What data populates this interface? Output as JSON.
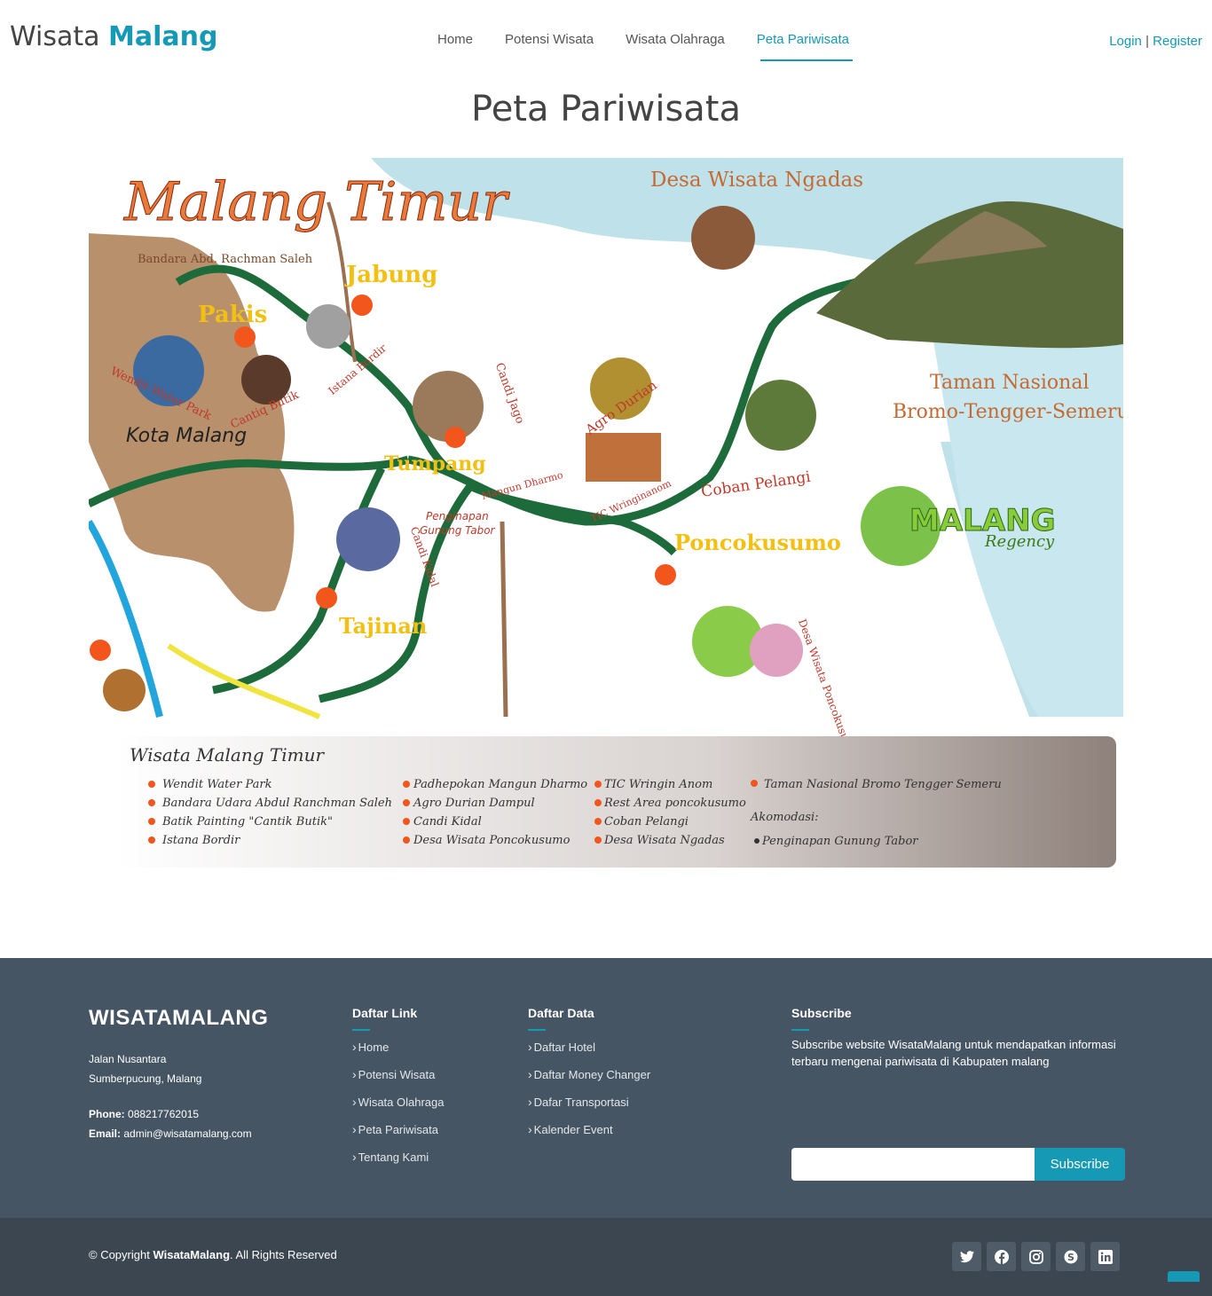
{
  "header": {
    "logo_light": "Wisata",
    "logo_bold": "Malang",
    "nav": [
      "Home",
      "Potensi Wisata",
      "Wisata Olahraga",
      "Peta Pariwisata"
    ],
    "login": "Login",
    "separator": "|",
    "register": "Register"
  },
  "page_title": "Peta Pariwisata",
  "map": {
    "title": "Malang Timur",
    "places": {
      "ngadas": "Desa Wisata Ngadas",
      "bandara": "Bandara Abd. Rachman Saleh",
      "jabung": "Jabung",
      "pakis": "Pakis",
      "istana": "Istana Bordir",
      "wendit": "Wendit Water Park",
      "cantiq": "Cantiq Butik",
      "kota": "Kota Malang",
      "jago": "Candi Jago",
      "agro": "Agro Durian",
      "bromo1": "Taman Nasional",
      "bromo2": "Bromo-Tengger-Semeru",
      "tumpang": "Tumpang",
      "mangun": "Mangun Dharmo",
      "tic": "TIC Wringinanom",
      "coban": "Coban Pelangi",
      "penginapan1": "Penginapan",
      "penginapan2": "Gunung Tabor",
      "kidal": "Candi Kidal",
      "poncokusumo": "Poncokusumo",
      "tajinan": "Tajinan",
      "desa_ponco": "Desa Wisata Poncokusumo",
      "regency1": "MALANG",
      "regency2": "Regency"
    },
    "legend_title": "Wisata Malang Timur",
    "legend_col1": [
      "Wendit Water Park",
      "Bandara Udara Abdul Ranchman Saleh",
      "Batik Painting \"Cantik Butik\"",
      "Istana Bordir"
    ],
    "legend_col2": [
      "Padhepokan Mangun Dharmo",
      "Agro Durian Dampul",
      "Candi Kidal",
      "Desa Wisata Poncokusumo"
    ],
    "legend_col3": [
      "TIC Wringin Anom",
      "Rest Area poncokusumo",
      "Coban Pelangi",
      "Desa Wisata Ngadas"
    ],
    "legend_col4": [
      "Taman Nasional Bromo Tengger Semeru"
    ],
    "akomodasi_label": "Akomodasi:",
    "akomodasi": "Penginapan Gunung Tabor"
  },
  "footer": {
    "brand": "WISATAMALANG",
    "address1": "Jalan Nusantara",
    "address2": "Sumberpucung, Malang",
    "phone_label": "Phone:",
    "phone": "088217762015",
    "email_label": "Email:",
    "email": "admin@wisatamalang.com",
    "links_title": "Daftar Link",
    "links": [
      "Home",
      "Potensi Wisata",
      "Wisata Olahraga",
      "Peta Pariwisata",
      "Tentang Kami"
    ],
    "data_title": "Daftar Data",
    "data_links": [
      "Daftar Hotel",
      "Daftar Money Changer",
      "Dafar Transportasi",
      "Kalender Event"
    ],
    "subscribe_title": "Subscribe",
    "subscribe_text": "Subscribe website WisataMalang untuk mendapatkan informasi terbaru mengenai pariwisata di Kabupaten malang",
    "subscribe_button": "Subscribe",
    "subscribe_value": ""
  },
  "bottom": {
    "copy_prefix": "© Copyright",
    "copy_brand": "WisataMalang",
    "copy_suffix": ". All Rights Reserved",
    "socials": [
      "twitter-icon",
      "facebook-icon",
      "instagram-icon",
      "skype-icon",
      "linkedin-icon"
    ]
  },
  "colors": {
    "accent": "#1599b5",
    "footer": "#465563",
    "footer_bottom": "#3b4651"
  }
}
